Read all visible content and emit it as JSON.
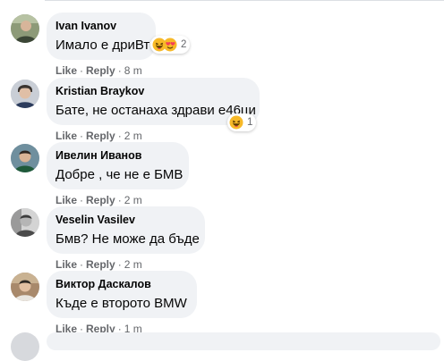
{
  "comments": [
    {
      "author": "Ivan Ivanov",
      "text": "Имало е дриВт",
      "actions": {
        "like": "Like",
        "reply": "Reply",
        "time": "8 m"
      },
      "reactions": {
        "icons": [
          "haha-emoji",
          "love-emoji"
        ],
        "count": "2"
      }
    },
    {
      "author": "Kristian Braykov",
      "text": "Бате, не останаха здрави е46ци",
      "actions": {
        "like": "Like",
        "reply": "Reply",
        "time": "2 m"
      },
      "reactions": {
        "icons": [
          "haha-emoji"
        ],
        "count": "1"
      }
    },
    {
      "author": "Ивелин Иванов",
      "text": "Добре , че не е БМВ",
      "actions": {
        "like": "Like",
        "reply": "Reply",
        "time": "2 m"
      }
    },
    {
      "author": "Veselin Vasilev",
      "text": "Бмв? Не може да бъде",
      "actions": {
        "like": "Like",
        "reply": "Reply",
        "time": "2 m"
      }
    },
    {
      "author": "Виктор Даскалов",
      "text": "Къде е второто BMW",
      "actions": {
        "like": "Like",
        "reply": "Reply",
        "time": "1 m"
      }
    }
  ],
  "separator": "·",
  "colors": {
    "bubble": "#f0f2f5",
    "author_text": "#050505",
    "meta_text": "#65676b",
    "haha_yellow": "#f7b928",
    "love_red": "#f33e58"
  }
}
